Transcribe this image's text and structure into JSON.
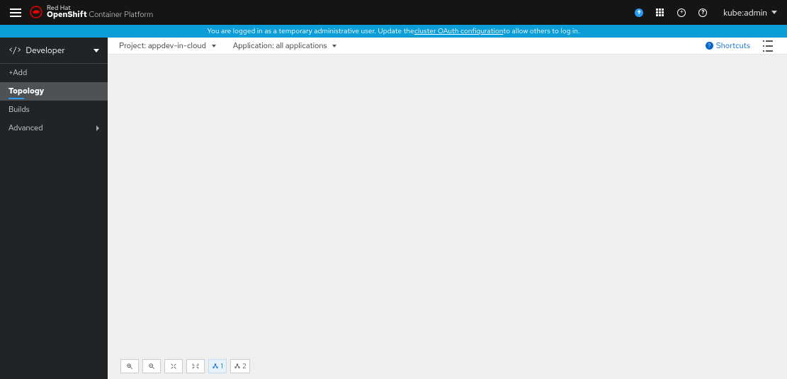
{
  "brand": {
    "line1": "Red Hat",
    "line2_bold": "OpenShift",
    "line2_light": " Container Platform"
  },
  "user": {
    "name": "kube:admin"
  },
  "banner": {
    "prefix": "You are logged in as a temporary administrative user. Update the ",
    "link": "cluster OAuth configuration",
    "suffix": " to allow others to log in."
  },
  "perspective": {
    "label": "Developer"
  },
  "sidebar": {
    "items": [
      {
        "label": "+Add",
        "active": false,
        "hasChildren": false
      },
      {
        "label": "Topology",
        "active": true,
        "hasChildren": false
      },
      {
        "label": "Builds",
        "active": false,
        "hasChildren": false
      },
      {
        "label": "Advanced",
        "active": false,
        "hasChildren": true
      }
    ]
  },
  "toolbar": {
    "project_label": "Project: ",
    "project_value": "appdev-in-cloud",
    "application_label": "Application: ",
    "application_value": "all applications",
    "shortcuts": "Shortcuts"
  },
  "controls": {
    "count1": "1",
    "count2": "2"
  },
  "colors": {
    "banner_bg": "#0a9dd7",
    "accent": "#2b9af3",
    "link": "#0066cc"
  }
}
